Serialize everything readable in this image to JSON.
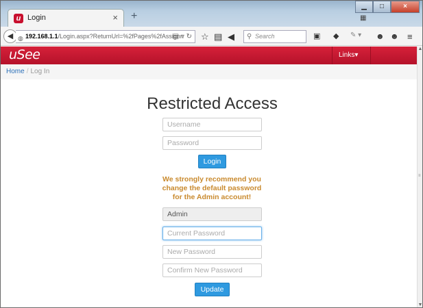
{
  "browser": {
    "tab_title": "Login",
    "tab_favicon_letter": "u",
    "tab_close": "×",
    "new_tab": "+",
    "url_host": "192.168.1.1",
    "url_path": "/Login.aspx?ReturnUrl=%2fPages%2fAssignn",
    "search_placeholder": "Search"
  },
  "site": {
    "brand": "uSee",
    "links_menu": "Links▾"
  },
  "breadcrumb": {
    "home": "Home",
    "separator": "/",
    "current": "Log In"
  },
  "login": {
    "heading": "Restricted Access",
    "username_placeholder": "Username",
    "password_placeholder": "Password",
    "login_button": "Login"
  },
  "warning": {
    "line1": "We strongly recommend you",
    "line2": "change the default password",
    "line3": "for the Admin account!"
  },
  "change_password": {
    "username_value": "Admin",
    "current_placeholder": "Current Password",
    "new_placeholder": "New Password",
    "confirm_placeholder": "Confirm New Password",
    "update_button": "Update"
  },
  "colors": {
    "brand_red": "#c8102e",
    "button_blue": "#2f9ae0",
    "warning_orange": "#c98a2e",
    "link_blue": "#2a6fb8"
  }
}
